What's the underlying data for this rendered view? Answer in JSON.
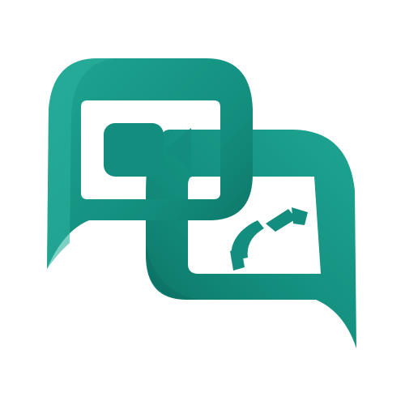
{
  "app": {
    "logo": {
      "icon_name": "video-and-voice-chat-bubbles-logo",
      "parts": {
        "left_bubble": "chat-bubble-icon",
        "right_bubble": "chat-bubble-icon",
        "video": "video-camera-icon",
        "phone": "phone-handset-icon"
      },
      "colors": {
        "primary": "#138E7E",
        "dark": "#0B6F62",
        "light": "#1FA592",
        "background": "#FFFFFF"
      }
    }
  }
}
